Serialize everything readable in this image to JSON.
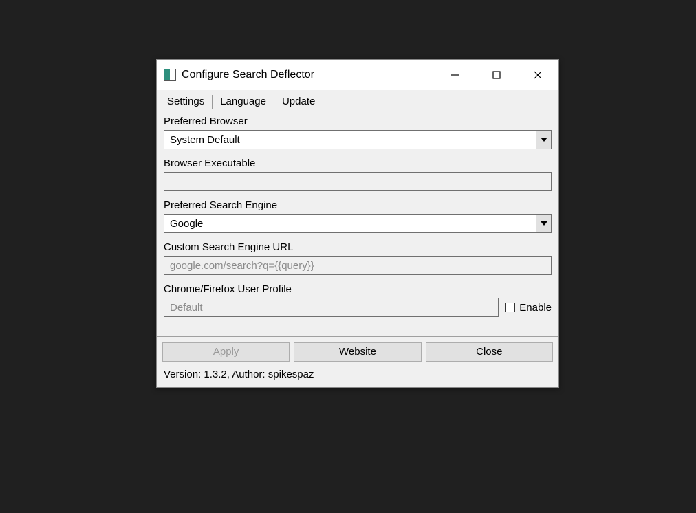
{
  "window": {
    "title": "Configure Search Deflector"
  },
  "tabs": {
    "settings": "Settings",
    "language": "Language",
    "update": "Update"
  },
  "fields": {
    "browser": {
      "label": "Preferred Browser",
      "value": "System Default"
    },
    "executable": {
      "label": "Browser Executable",
      "value": ""
    },
    "engine": {
      "label": "Preferred Search Engine",
      "value": "Google"
    },
    "customUrl": {
      "label": "Custom Search Engine URL",
      "value": "google.com/search?q={{query}}"
    },
    "profile": {
      "label": "Chrome/Firefox User Profile",
      "value": "Default",
      "enableLabel": "Enable"
    }
  },
  "buttons": {
    "apply": "Apply",
    "website": "Website",
    "close": "Close"
  },
  "status": "Version: 1.3.2, Author: spikespaz"
}
